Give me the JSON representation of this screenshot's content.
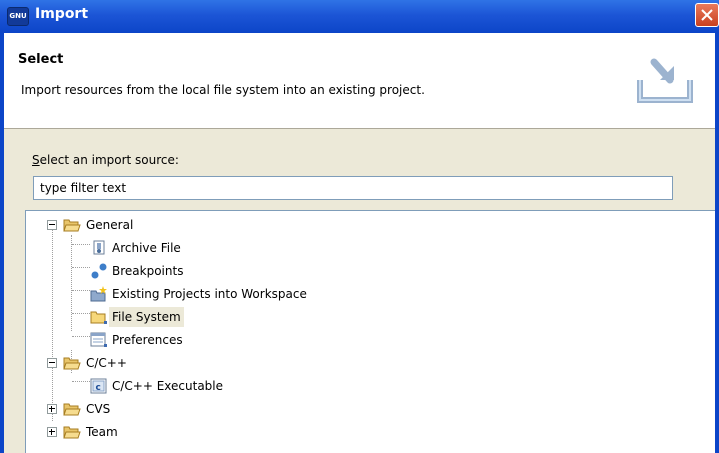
{
  "window": {
    "title": "Import",
    "icon_text": "GNU"
  },
  "header": {
    "title": "Select",
    "description": "Import resources from the local file system into an existing project."
  },
  "source": {
    "label_first": "S",
    "label_rest": "elect an import source:",
    "filter_value": "type filter text"
  },
  "tree": {
    "general": "General",
    "archive_file": "Archive File",
    "breakpoints": "Breakpoints",
    "existing_projects": "Existing Projects into Workspace",
    "file_system": "File System",
    "preferences": "Preferences",
    "cpp": "C/C++",
    "cpp_executable": "C/C++ Executable",
    "cvs": "CVS",
    "team": "Team"
  },
  "colors": {
    "title_bar": "#0c45c8",
    "dialog": "#ece9d8",
    "selection": "#ece9d8"
  }
}
